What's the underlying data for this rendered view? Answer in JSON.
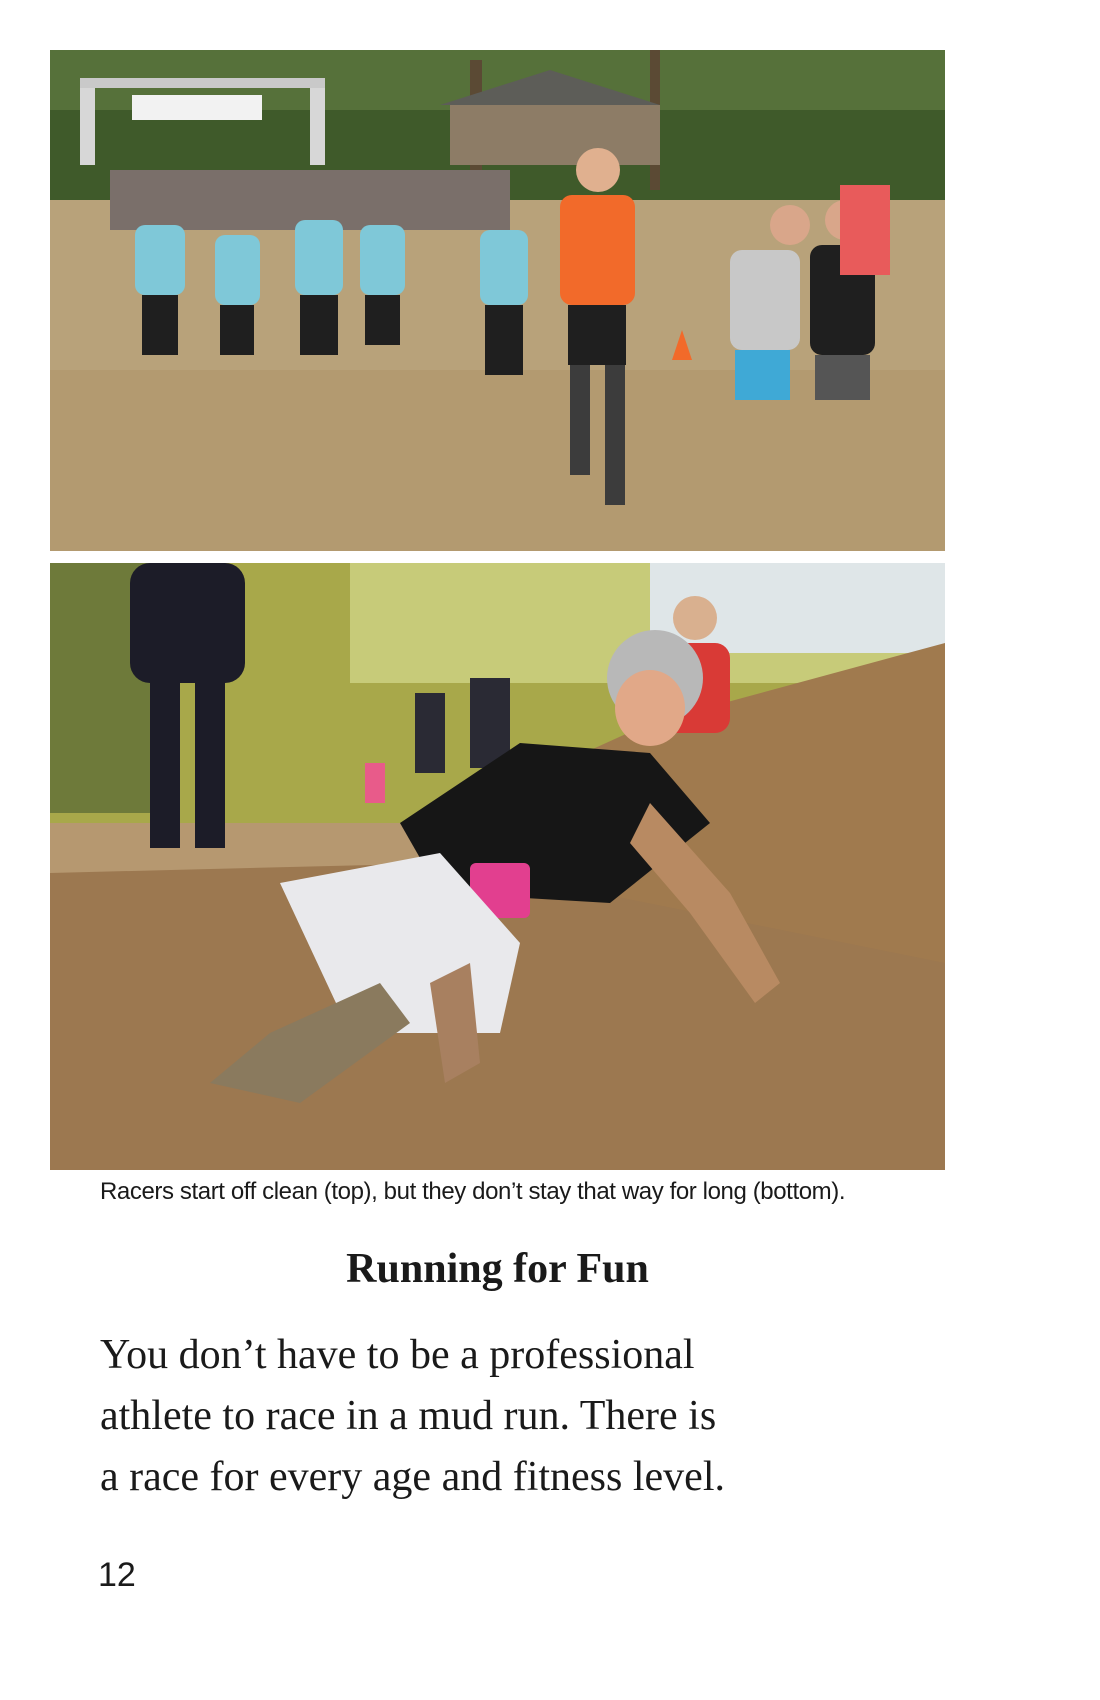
{
  "photos": {
    "top": {
      "subject": "racers-start-clean"
    },
    "bottom": {
      "subject": "racer-crawling-in-mud"
    }
  },
  "caption": "Racers start off clean (top), but they don’t stay that way for long (bottom).",
  "heading": "Running for Fun",
  "body": {
    "lines": [
      "You don’t have to be a professional",
      "athlete to race in a mud run. There is",
      "a race for every age and fitness level."
    ]
  },
  "page_number": "12",
  "colors": {
    "text": "#1a1a1a",
    "sand": "#b8a27a",
    "mud": "#8a6a43",
    "trees": "#3f5a2a",
    "teal_shirt": "#7fc8d8",
    "orange_shirt": "#f26a2a",
    "pink_bib": "#e23f8f"
  }
}
